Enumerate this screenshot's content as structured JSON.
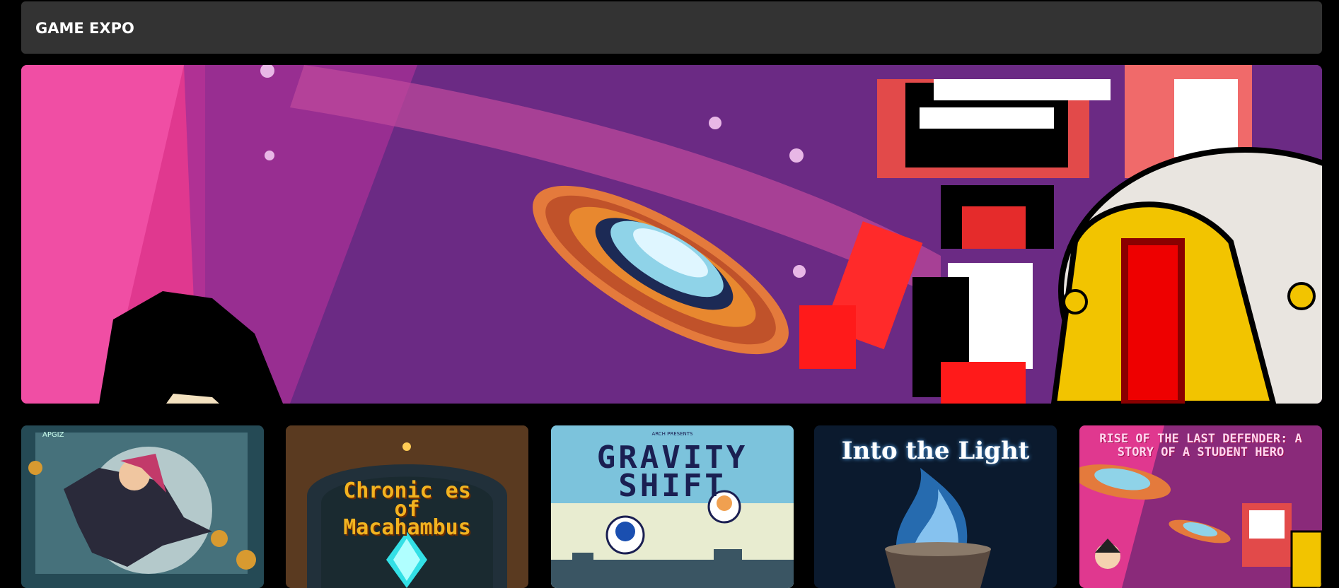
{
  "header": {
    "title": "GAME EXPO"
  },
  "hero": {
    "description_icon": "space-hero-banner"
  },
  "games": [
    {
      "title": "",
      "badge": "APGIZ"
    },
    {
      "title": "Chronic es\nof\nMacahambus"
    },
    {
      "title": "GRAVITY\nSHIFT",
      "kicker": "ARCH PRESENTS"
    },
    {
      "title": "Into the Light"
    },
    {
      "title": "RISE OF THE LAST DEFENDER: A STORY OF A STUDENT HERO"
    }
  ],
  "colors": {
    "background": "#000000",
    "header_bg": "#333333",
    "header_text": "#ffffff",
    "hero_purple": "#6b2a84",
    "hero_pink": "#e0388f"
  }
}
